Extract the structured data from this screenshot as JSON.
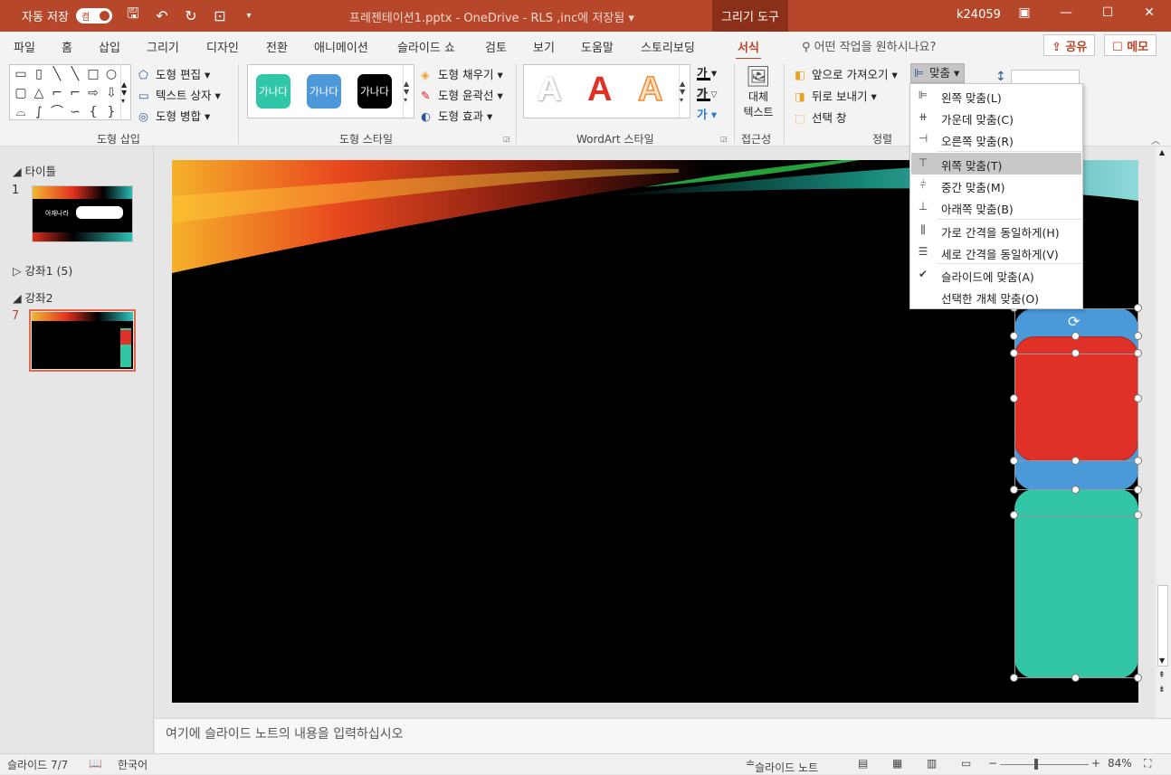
{
  "titlebar": {
    "autosave_label": "자동 저장",
    "autosave_state": "켬",
    "doc_title": "프레젠테이션1.pptx  -  OneDrive - RLS ,inc에 저장됨  ▾",
    "context_tab": "그리기 도구",
    "user": "k24059"
  },
  "tabs": [
    "파일",
    "홈",
    "삽입",
    "그리기",
    "디자인",
    "전환",
    "애니메이션",
    "슬라이드 쇼",
    "검토",
    "보기",
    "도움말",
    "스토리보딩",
    "서식"
  ],
  "active_tab": "서식",
  "tellme": "어떤 작업을 원하시나요?",
  "share_label": "공유",
  "comments_label": "메모",
  "ribbon": {
    "insert_shapes": {
      "edit_shape": "도형 편집",
      "text_box": "텍스트 상자",
      "merge_shapes": "도형 병합",
      "label": "도형 삽입"
    },
    "shape_styles": {
      "swatch_text": "가나다",
      "fill": "도형 채우기",
      "outline": "도형 윤곽선",
      "effects": "도형 효과",
      "label": "도형 스타일"
    },
    "wordart": {
      "letter": "A",
      "text_small": "가",
      "label": "WordArt 스타일"
    },
    "accessibility": {
      "alt_text_1": "대체",
      "alt_text_2": "텍스트",
      "label": "접근성"
    },
    "arrange": {
      "bring_forward": "앞으로 가져오기",
      "send_backward": "뒤로 보내기",
      "selection_pane": "선택 창",
      "align": "맞춤",
      "label": "정렬"
    }
  },
  "align_menu": [
    {
      "label": "왼쪽 맞춤(L)",
      "icon": "align-left-icon"
    },
    {
      "label": "가운데 맞춤(C)",
      "icon": "align-center-icon"
    },
    {
      "label": "오른쪽 맞춤(R)",
      "icon": "align-right-icon"
    },
    {
      "label": "위쪽 맞춤(T)",
      "icon": "align-top-icon",
      "highlighted": true
    },
    {
      "label": "중간 맞춤(M)",
      "icon": "align-middle-icon"
    },
    {
      "label": "아래쪽 맞춤(B)",
      "icon": "align-bottom-icon"
    },
    {
      "label": "가로 간격을 동일하게(H)",
      "icon": "distribute-horizontal-icon"
    },
    {
      "label": "세로 간격을 동일하게(V)",
      "icon": "distribute-vertical-icon"
    },
    {
      "label": "슬라이드에 맞춤(A)",
      "icon": "checkmark-icon",
      "checked": true
    },
    {
      "label": "선택한 개체 맞춤(O)",
      "icon": ""
    }
  ],
  "slides_panel": {
    "section_title": "타이틀",
    "section_lecture1": "강좌1 (5)",
    "section_lecture2": "강좌2",
    "slide1_num": "1",
    "slide7_num": "7",
    "slide1_text": "아재나라"
  },
  "notes_placeholder": "여기에 슬라이드 노트의 내용을 입력하십시오",
  "status": {
    "slide_counter": "슬라이드 7/7",
    "language": "한국어",
    "notes_toggle": "슬라이드 노트",
    "zoom": "84%"
  },
  "colors": {
    "accent": "#b7472a",
    "shape_blue": "#4a99d9",
    "shape_red": "#e03128",
    "shape_teal": "#32c6a6",
    "swatch_teal": "#2fc7a7",
    "swatch_blue": "#4d98d9",
    "swatch_black": "#000000"
  }
}
